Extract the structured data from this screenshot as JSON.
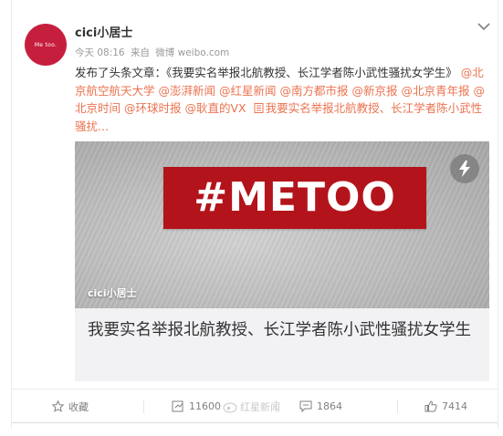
{
  "author": {
    "avatar_text": "Me too.",
    "name": "cici小居士",
    "time": "今天 08:16",
    "source_prefix": "来自",
    "source": "微博 weibo.com"
  },
  "post": {
    "lead": "发布了头条文章：《我要实名举报北航教授、长江学者陈小武性骚扰女学生》",
    "mentions": [
      "@北京航空航天大学",
      "@澎湃新闻",
      "@红星新闻",
      "@南方都市报",
      "@新京报",
      "@北京青年报",
      "@北京时间",
      "@环球时报",
      "@耿直的VX"
    ],
    "attachment_text": "我要实名举报北航教授、长江学者陈小武性骚扰...",
    "attachment_icon": "article-icon"
  },
  "article": {
    "cover_text": "#METOO",
    "cover_author": "cici小居士",
    "title": "我要实名举报北航教授、长江学者陈小武性骚扰女学生",
    "badge_icon": "lightning-icon"
  },
  "actions": {
    "favorite_label": "收藏",
    "repost_count": "11600",
    "comment_count": "1864",
    "like_count": "7414"
  },
  "watermark": "红星新闻",
  "colors": {
    "link": "#eb7350",
    "avatar_bg": "#c61f3e",
    "banner_bg": "#b3141b"
  }
}
